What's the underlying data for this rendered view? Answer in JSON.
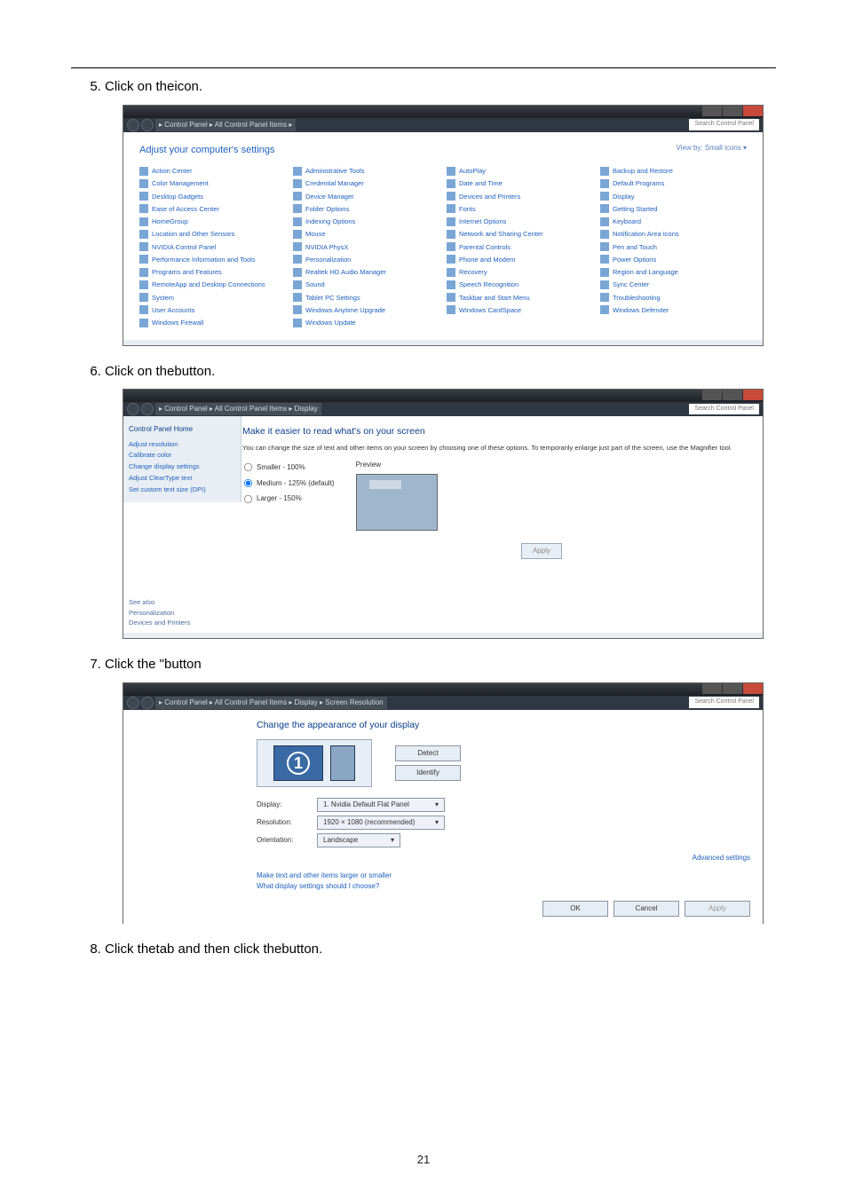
{
  "page_number": "21",
  "step5": {
    "a": "Click on the",
    "b": "icon."
  },
  "step6": {
    "a": "Click on the",
    "b": "button."
  },
  "step7": {
    "a": "Click the \"",
    "b": "button"
  },
  "step8": {
    "a": "Click the",
    "b": "tab and then click the",
    "c": "button."
  },
  "cp": {
    "breadcrumb": "▸ Control Panel ▸ All Control Panel Items ▸",
    "search_ph": "Search Control Panel",
    "title": "Adjust your computer's settings",
    "view_by": "View by:  Small icons ▾",
    "items": [
      "Action Center",
      "Administrative Tools",
      "AutoPlay",
      "Backup and Restore",
      "Color Management",
      "Credential Manager",
      "Date and Time",
      "Default Programs",
      "Desktop Gadgets",
      "Device Manager",
      "Devices and Printers",
      "Display",
      "Ease of Access Center",
      "Folder Options",
      "Fonts",
      "Getting Started",
      "HomeGroup",
      "Indexing Options",
      "Internet Options",
      "Keyboard",
      "Location and Other Sensors",
      "Mouse",
      "Network and Sharing Center",
      "Notification Area Icons",
      "NVIDIA Control Panel",
      "NVIDIA PhysX",
      "Parental Controls",
      "Pen and Touch",
      "Performance Information and Tools",
      "Personalization",
      "Phone and Modem",
      "Power Options",
      "Programs and Features",
      "Realtek HD Audio Manager",
      "Recovery",
      "Region and Language",
      "RemoteApp and Desktop Connections",
      "Sound",
      "Speech Recognition",
      "Sync Center",
      "System",
      "Tablet PC Settings",
      "Taskbar and Start Menu",
      "Troubleshooting",
      "User Accounts",
      "Windows Anytime Upgrade",
      "Windows CardSpace",
      "Windows Defender",
      "Windows Firewall",
      "Windows Update"
    ]
  },
  "disp": {
    "breadcrumb": "▸ Control Panel ▸ All Control Panel Items ▸ Display",
    "title": "Make it easier to read what's on your screen",
    "desc": "You can change the size of text and other items on your screen by choosing one of these options. To temporarily enlarge just part of the screen, use the Magnifier tool.",
    "opt1": "Smaller - 100%",
    "opt2": "Medium - 125% (default)",
    "opt3": "Larger - 150%",
    "preview": "Preview",
    "apply": "Apply",
    "side": {
      "home": "Control Panel Home",
      "l1": "Adjust resolution",
      "l2": "Calibrate color",
      "l3": "Change display settings",
      "l4": "Adjust ClearType text",
      "l5": "Set custom text size (DPI)",
      "also": "See also",
      "a1": "Personalization",
      "a2": "Devices and Printers"
    }
  },
  "res": {
    "breadcrumb": "▸ Control Panel ▸ All Control Panel Items ▸ Display ▸ Screen Resolution",
    "title": "Change the appearance of your display",
    "detect": "Detect",
    "identify": "Identify",
    "lab_display": "Display:",
    "val_display": "1. Nvidia Default Flat Panel",
    "lab_resolution": "Resolution:",
    "val_resolution": "1920 × 1080 (recommended)",
    "lab_orientation": "Orientation:",
    "val_orientation": "Landscape",
    "adv": "Advanced settings",
    "lnk1": "Make text and other items larger or smaller",
    "lnk2": "What display settings should I choose?",
    "ok": "OK",
    "cancel": "Cancel",
    "apply": "Apply"
  }
}
